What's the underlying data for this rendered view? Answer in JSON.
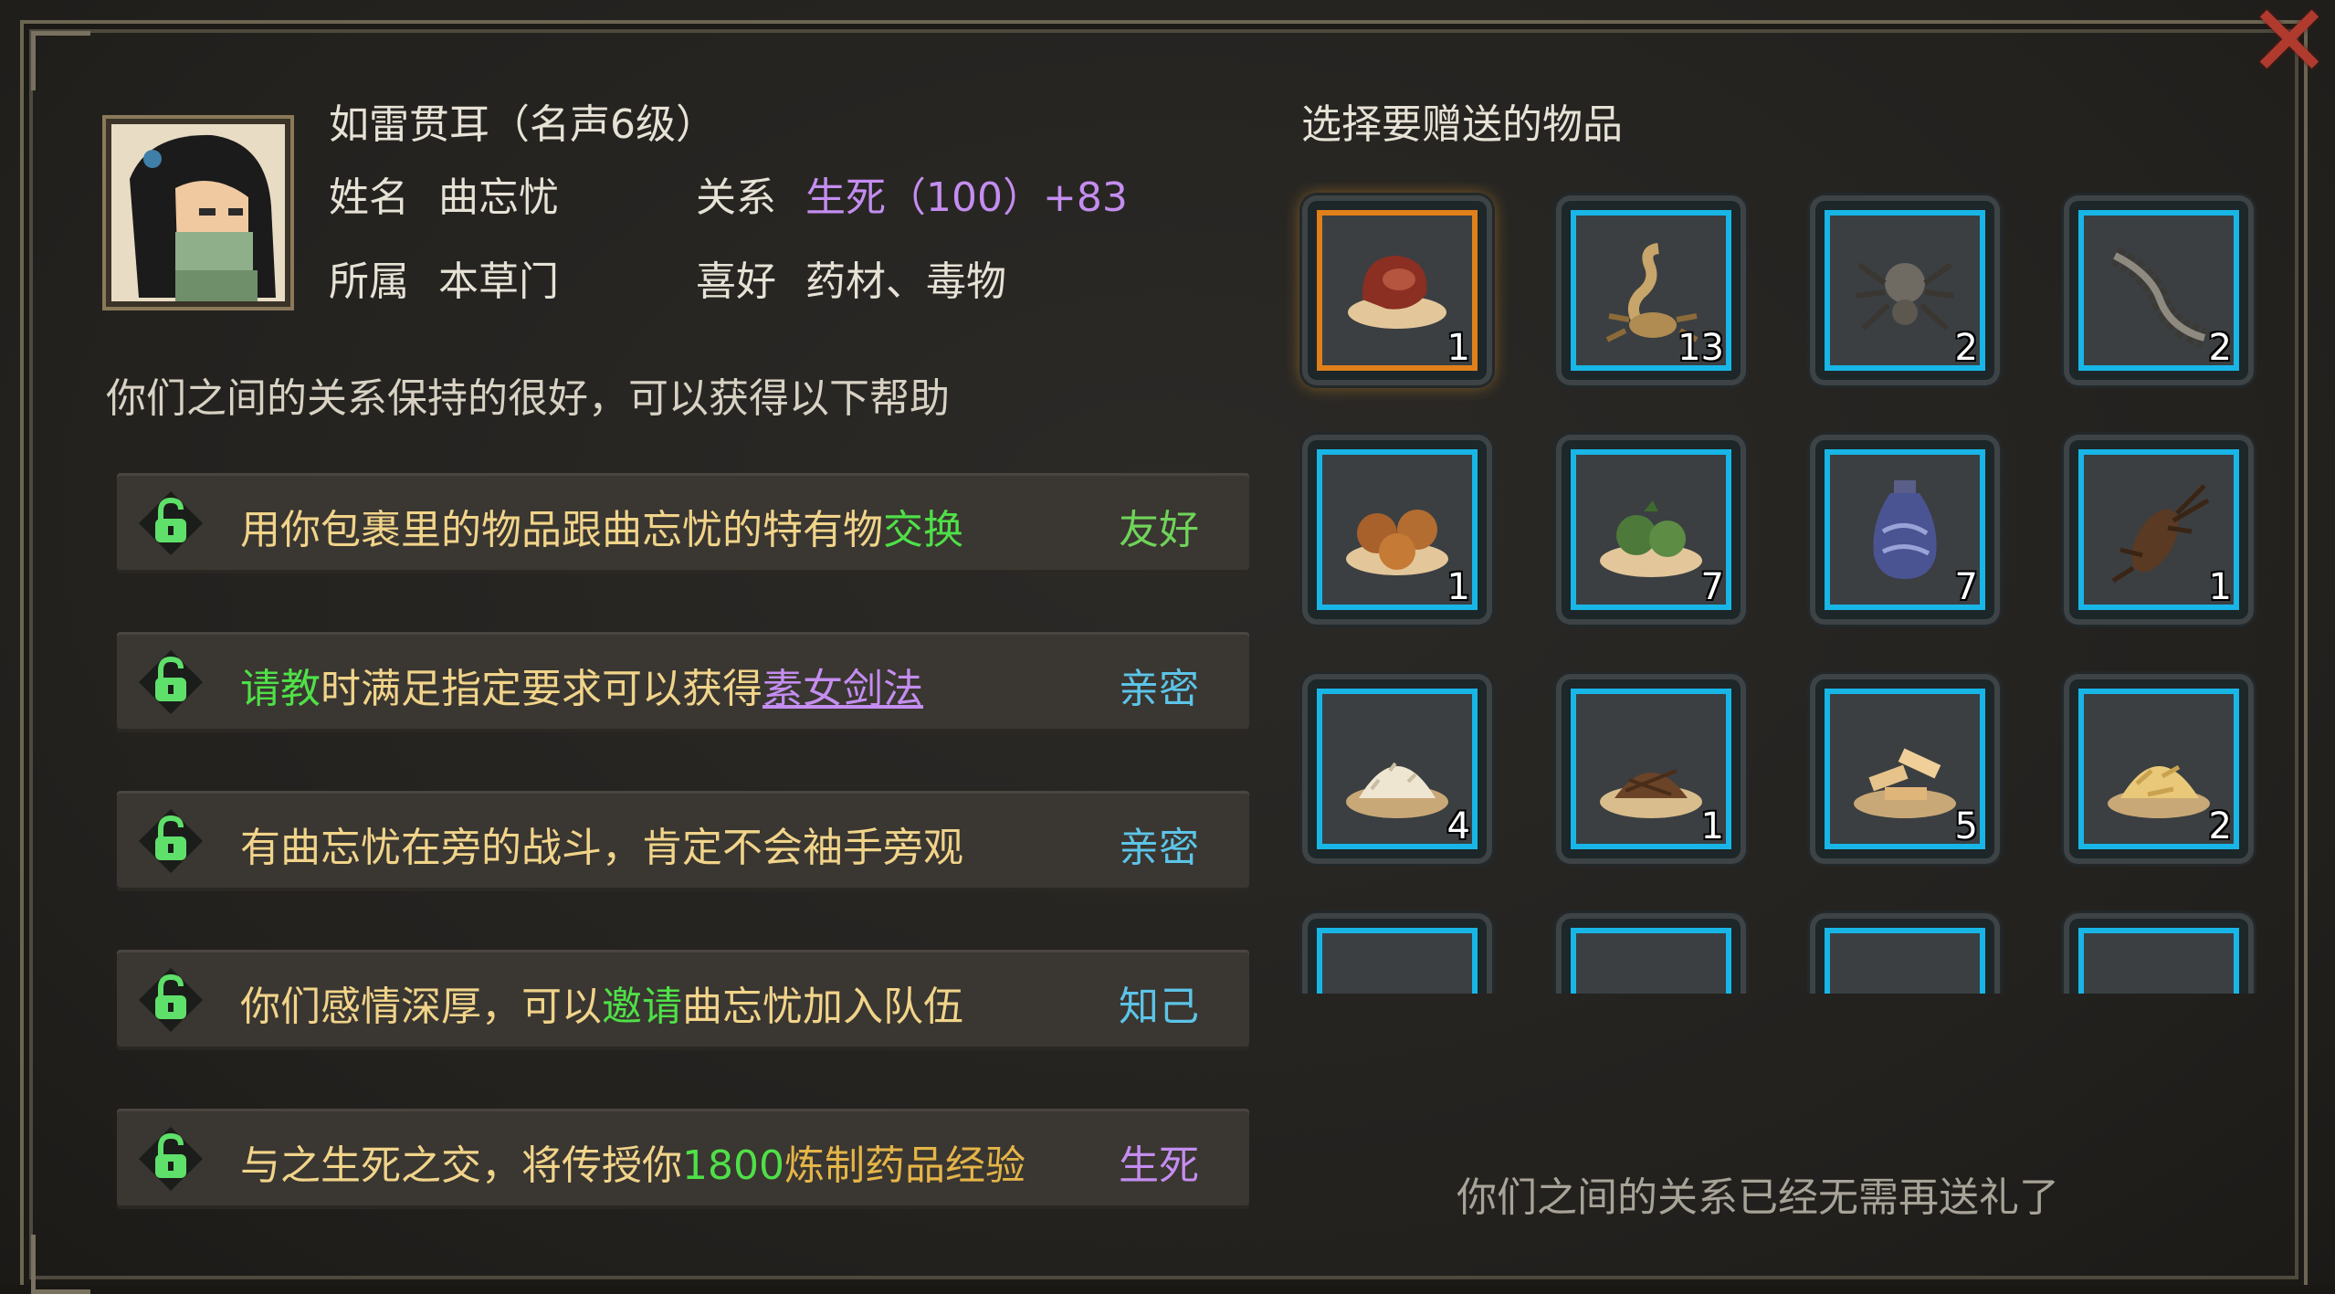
{
  "header": {
    "title": "如雷贯耳（名声6级）",
    "name_label": "姓名",
    "name_value": "曲忘忧",
    "relation_label": "关系",
    "relation_value": "生死（100）+83",
    "faction_label": "所属",
    "faction_value": "本草门",
    "hobby_label": "喜好",
    "hobby_value": "药材、毒物"
  },
  "intro": "你们之间的关系保持的很好，可以获得以下帮助",
  "benefits": [
    {
      "parts": [
        "用你包裹里的物品跟曲忘忧的特有物",
        "交换"
      ],
      "tag": "友好"
    },
    {
      "parts": [
        "请教",
        "时满足指定要求可以获得",
        "素女剑法"
      ],
      "tag": "亲密"
    },
    {
      "parts": [
        "有曲忘忧在旁的战斗，肯定不会袖手旁观"
      ],
      "tag": "亲密"
    },
    {
      "parts": [
        "你们感情深厚，可以",
        "邀请",
        "曲忘忧加入队伍"
      ],
      "tag": "知己"
    },
    {
      "parts": [
        "与之生死之交，将传授你",
        "1800",
        "炼制药品经验"
      ],
      "tag": "生死"
    }
  ],
  "gift": {
    "title": "选择要赠送的物品",
    "items": [
      {
        "icon": "mushroom-icon",
        "count": "1"
      },
      {
        "icon": "scorpion-icon",
        "count": "13"
      },
      {
        "icon": "spider-icon",
        "count": "2"
      },
      {
        "icon": "centipede-icon",
        "count": "2"
      },
      {
        "icon": "nuts-icon",
        "count": "1"
      },
      {
        "icon": "herb-fruit-icon",
        "count": "7"
      },
      {
        "icon": "vase-icon",
        "count": "7"
      },
      {
        "icon": "cricket-icon",
        "count": "1"
      },
      {
        "icon": "white-grain-icon",
        "count": "4"
      },
      {
        "icon": "brown-herb-icon",
        "count": "1"
      },
      {
        "icon": "sliced-root-icon",
        "count": "5"
      },
      {
        "icon": "gold-pieces-icon",
        "count": "2"
      },
      {
        "icon": "wood-icon",
        "count": ""
      },
      {
        "icon": "white-flakes-icon",
        "count": ""
      },
      {
        "icon": "bark-icon",
        "count": ""
      },
      {
        "icon": "beetle-icon",
        "count": ""
      }
    ],
    "footer": "你们之间的关系已经无需再送礼了"
  },
  "colors": {
    "friendly": "#6fd35a",
    "intimate": "#5cc4e8",
    "confidant": "#5cc4e8",
    "lifedeath": "#c48df0",
    "slot_border": "#18b6e6",
    "slot_selected": "#e0801a"
  }
}
